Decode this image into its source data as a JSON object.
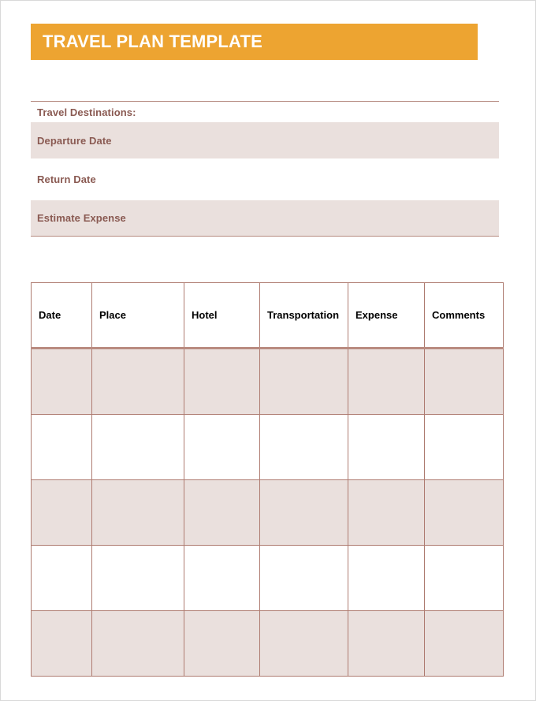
{
  "document": {
    "title": "TRAVEL PLAN TEMPLATE"
  },
  "info": {
    "destinations_label": "Travel Destinations:",
    "rows": [
      {
        "label": "Departure Date",
        "value": ""
      },
      {
        "label": "Return Date",
        "value": ""
      },
      {
        "label": "Estimate Expense",
        "value": ""
      }
    ]
  },
  "schedule": {
    "columns": [
      "Date",
      "Place",
      "Hotel",
      "Transportation",
      "Expense",
      "Comments"
    ],
    "rows": [
      [
        "",
        "",
        "",
        "",
        "",
        ""
      ],
      [
        "",
        "",
        "",
        "",
        "",
        ""
      ],
      [
        "",
        "",
        "",
        "",
        "",
        ""
      ],
      [
        "",
        "",
        "",
        "",
        "",
        ""
      ],
      [
        "",
        "",
        "",
        "",
        "",
        ""
      ]
    ]
  },
  "colors": {
    "banner": "#eda431",
    "shaded_row": "#eae0dd",
    "accent_text": "#8a5a52",
    "table_border": "#ae7b70",
    "header_rule": "#b98b80",
    "page_border": "#d9d9d9"
  }
}
